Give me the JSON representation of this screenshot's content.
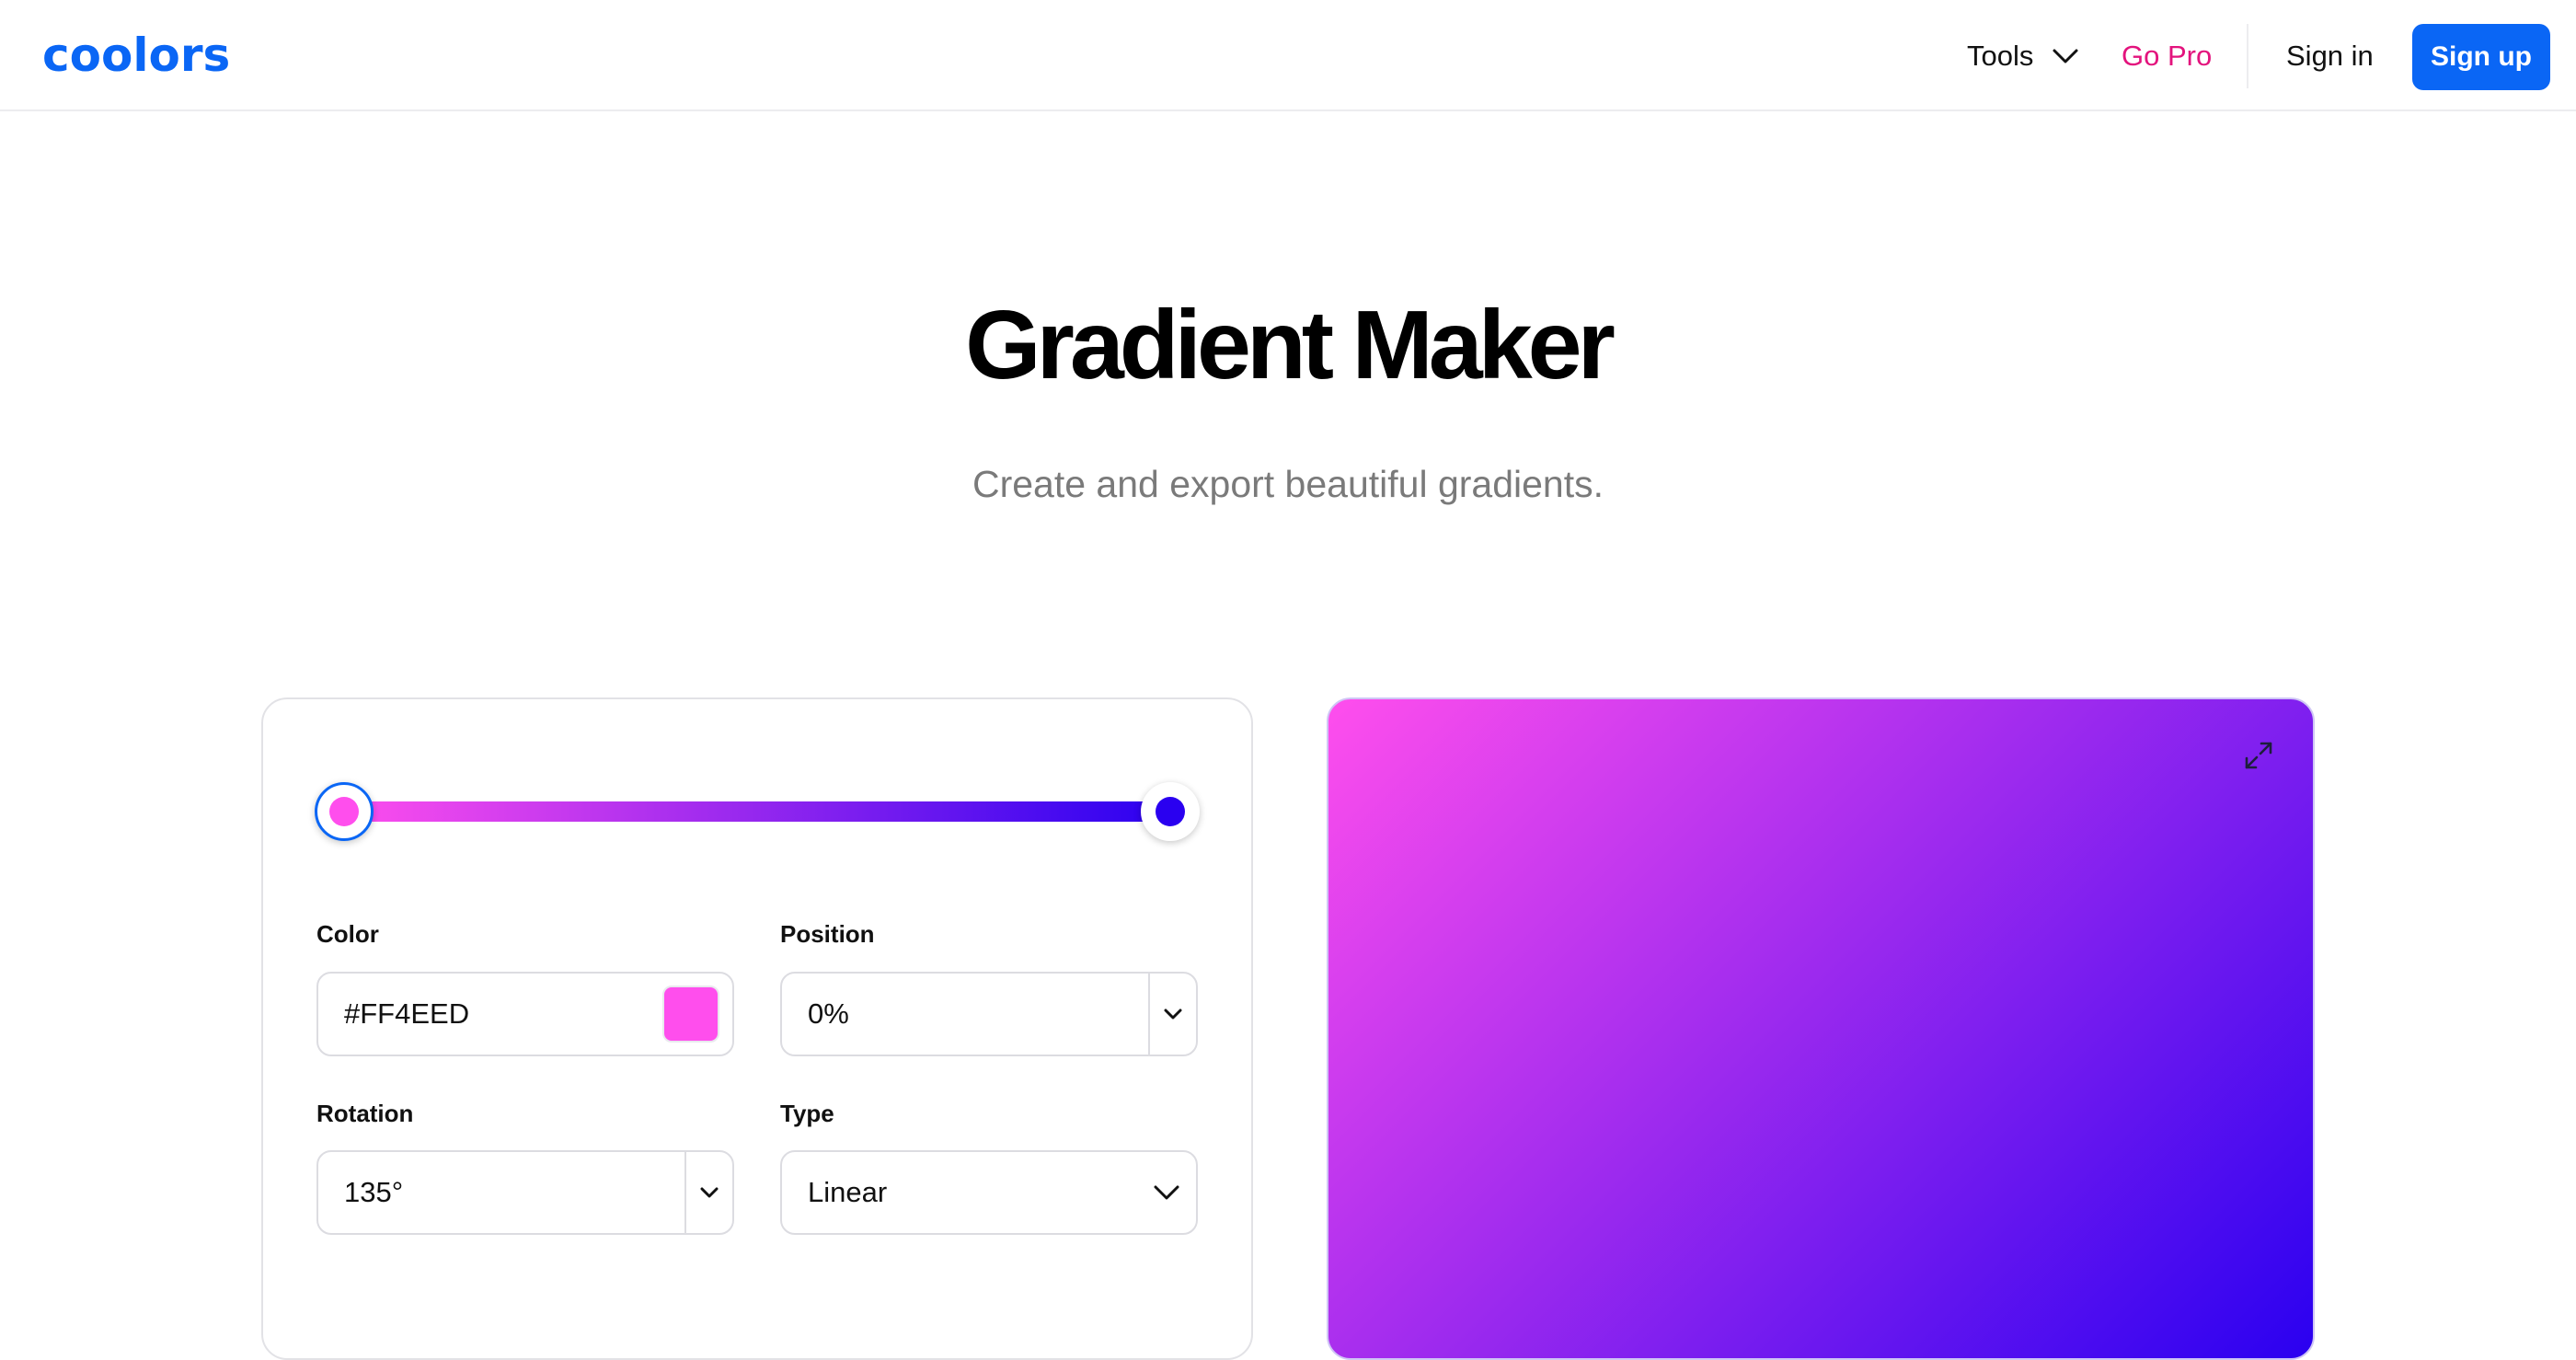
{
  "header": {
    "logo_text": "coolors",
    "nav": {
      "tools_label": "Tools",
      "gopro_label": "Go Pro",
      "signin_label": "Sign in",
      "signup_label": "Sign up"
    }
  },
  "hero": {
    "title": "Gradient Maker",
    "subtitle": "Create and export beautiful gradients."
  },
  "editor": {
    "stops": [
      {
        "color": "#FF4EED",
        "position_percent": 0,
        "selected": true
      },
      {
        "color": "#2A00F0",
        "position_percent": 100,
        "selected": false
      }
    ],
    "color_label": "Color",
    "color_value": "#FF4EED",
    "position_label": "Position",
    "position_value": "0%",
    "rotation_label": "Rotation",
    "rotation_value": "135°",
    "type_label": "Type",
    "type_value": "Linear"
  },
  "preview": {
    "gradient": {
      "type": "linear",
      "angle_deg": 135,
      "from": "#FF4EED",
      "to": "#2A00F0"
    }
  },
  "colors": {
    "brand_blue": "#0A66F5",
    "gopro_pink": "#E3137D"
  },
  "icons": [
    "chevron-down-icon",
    "expand-icon"
  ]
}
